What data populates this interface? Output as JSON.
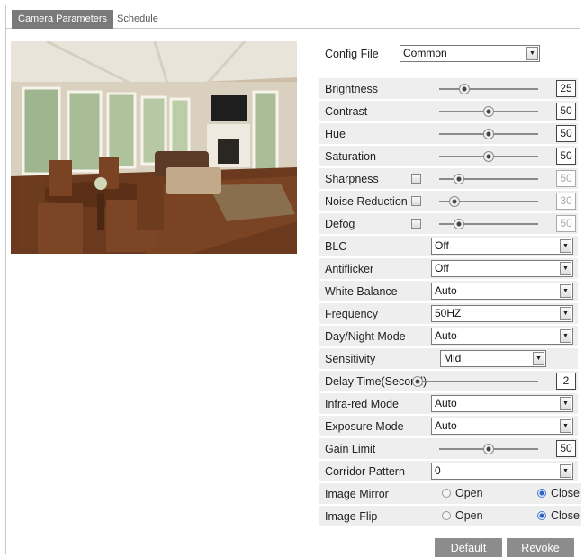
{
  "tabs": {
    "active": "Camera Parameters",
    "other": "Schedule"
  },
  "config_file": {
    "label": "Config File",
    "value": "Common"
  },
  "sliders": {
    "brightness": {
      "label": "Brightness",
      "value": "25",
      "level": 0.25
    },
    "contrast": {
      "label": "Contrast",
      "value": "50",
      "level": 0.5
    },
    "hue": {
      "label": "Hue",
      "value": "50",
      "level": 0.5
    },
    "saturation": {
      "label": "Saturation",
      "value": "50",
      "level": 0.5
    },
    "sharpness": {
      "label": "Sharpness",
      "value": "50",
      "level": 0.2,
      "enabled": false
    },
    "noise_reduction": {
      "label": "Noise Reduction",
      "value": "30",
      "level": 0.15,
      "enabled": false
    },
    "defog": {
      "label": "Defog",
      "value": "50",
      "level": 0.2,
      "enabled": false
    },
    "delay_time": {
      "label": "Delay Time(Second)",
      "value": "2",
      "level": 0.0
    },
    "gain_limit": {
      "label": "Gain Limit",
      "value": "50",
      "level": 0.5
    }
  },
  "selects": {
    "blc": {
      "label": "BLC",
      "value": "Off"
    },
    "antiflicker": {
      "label": "Antiflicker",
      "value": "Off"
    },
    "white_balance": {
      "label": "White Balance",
      "value": "Auto"
    },
    "frequency": {
      "label": "Frequency",
      "value": "50HZ"
    },
    "day_night": {
      "label": "Day/Night Mode",
      "value": "Auto"
    },
    "sensitivity": {
      "label": "Sensitivity",
      "value": "Mid"
    },
    "infrared": {
      "label": "Infra-red Mode",
      "value": "Auto"
    },
    "exposure": {
      "label": "Exposure Mode",
      "value": "Auto"
    },
    "corridor": {
      "label": "Corridor Pattern",
      "value": "0"
    }
  },
  "radios": {
    "mirror": {
      "label": "Image Mirror",
      "open": "Open",
      "close": "Close",
      "selected": "close"
    },
    "flip": {
      "label": "Image Flip",
      "open": "Open",
      "close": "Close",
      "selected": "close"
    }
  },
  "buttons": {
    "default": "Default",
    "revoke": "Revoke"
  },
  "colors": {
    "active_tab": "#7a7a7a",
    "row_shade": "#eeeeee",
    "button": "#8c8c8c",
    "radio_selected": "#2a62c8"
  }
}
